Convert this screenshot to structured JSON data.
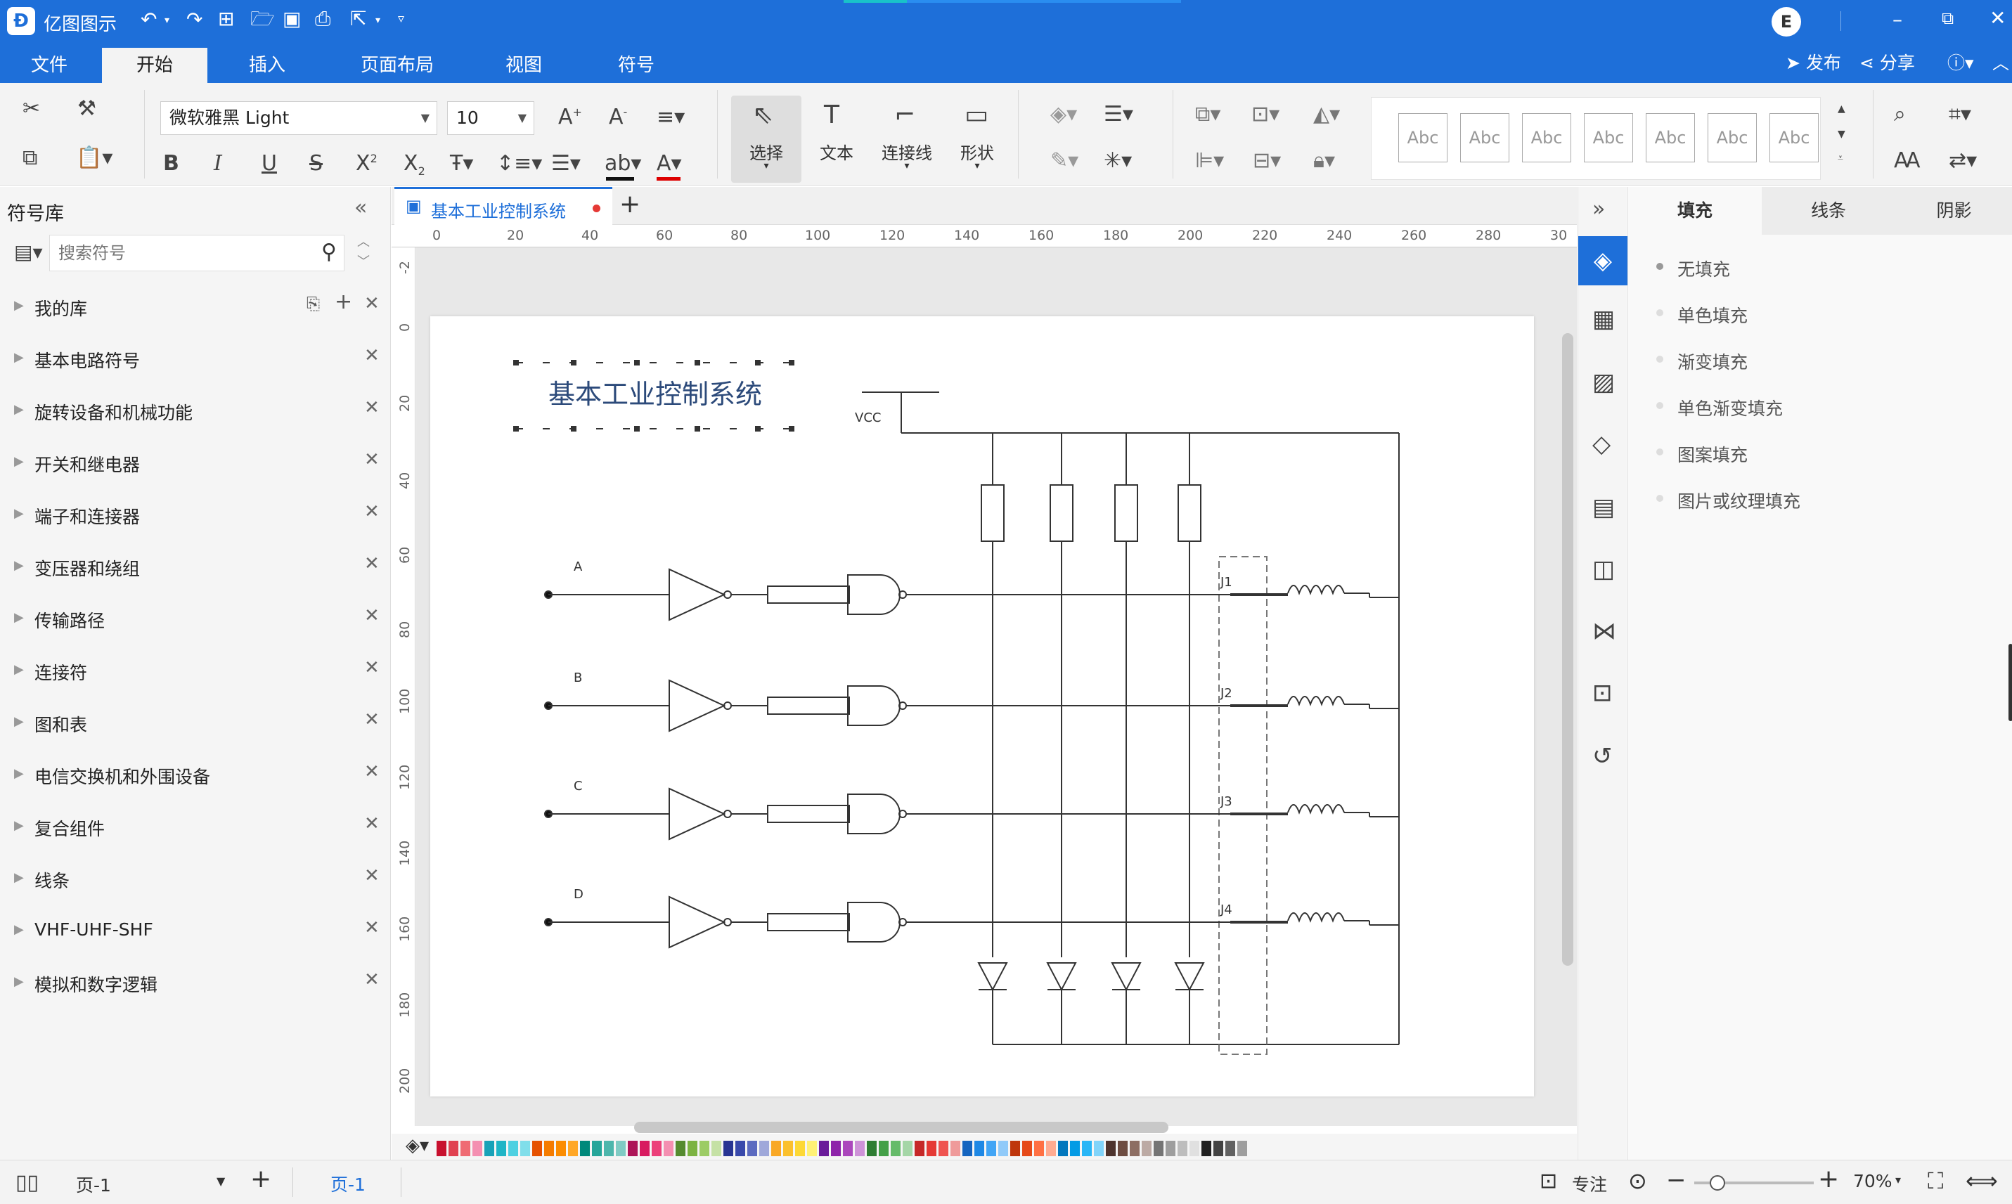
{
  "app": {
    "title": "亿图图示",
    "user_initial": "E"
  },
  "menu": {
    "tabs": [
      "文件",
      "开始",
      "插入",
      "页面布局",
      "视图",
      "符号"
    ],
    "active": "开始",
    "publish": "发布",
    "share": "分享"
  },
  "ribbon": {
    "font_name": "微软雅黑 Light",
    "font_size": "10",
    "tools": {
      "select": "选择",
      "text": "文本",
      "connector": "连接线",
      "shape": "形状"
    },
    "style_samples": [
      "Abc",
      "Abc",
      "Abc",
      "Abc",
      "Abc",
      "Abc",
      "Abc"
    ]
  },
  "library": {
    "title": "符号库",
    "search_placeholder": "搜索符号",
    "items": [
      "我的库",
      "基本电路符号",
      "旋转设备和机械功能",
      "开关和继电器",
      "端子和连接器",
      "变压器和绕组",
      "传输路径",
      "连接符",
      "图和表",
      "电信交换机和外围设备",
      "复合组件",
      "线条",
      "VHF-UHF-SHF",
      "模拟和数字逻辑"
    ]
  },
  "document": {
    "tab_title": "基本工业控制系统"
  },
  "ruler": {
    "h_labels": [
      "0",
      "20",
      "40",
      "60",
      "80",
      "100",
      "120",
      "140",
      "160",
      "180",
      "200",
      "220",
      "240",
      "260",
      "280",
      "30"
    ],
    "v_labels": [
      "-2",
      "0",
      "20",
      "40",
      "60",
      "80",
      "100",
      "120",
      "140",
      "160",
      "180",
      "200"
    ]
  },
  "diagram": {
    "title": "基本工业控制系统",
    "vcc": "VCC",
    "inputs": [
      "A",
      "B",
      "C",
      "D"
    ],
    "relays": [
      "J1",
      "J2",
      "J3",
      "J4"
    ]
  },
  "right_panel": {
    "tabs": [
      "填充",
      "线条",
      "阴影"
    ],
    "active_tab": "填充",
    "fill_options": [
      "无填充",
      "单色填充",
      "渐变填充",
      "单色渐变填充",
      "图案填充",
      "图片或纹理填充"
    ],
    "selected_fill": "无填充"
  },
  "status": {
    "page_selector": "页-1",
    "page_tab": "页-1",
    "focus": "专注",
    "zoom": "70%"
  },
  "colors": {
    "accent": "#1e6fd9",
    "doc_title": "#2c4a7a"
  },
  "palette": [
    "#c8102e",
    "#e04050",
    "#ef6b73",
    "#f48fb1",
    "#17a2b8",
    "#1fb5c6",
    "#4dd0e1",
    "#80deea",
    "#e65100",
    "#f57c00",
    "#fb8c00",
    "#ffa726",
    "#00897b",
    "#26a69a",
    "#4db6ac",
    "#80cbc4",
    "#ad1457",
    "#d81b60",
    "#ec407a",
    "#f48fb1",
    "#558b2f",
    "#7cb342",
    "#9ccc65",
    "#c5e1a5",
    "#283593",
    "#3949ab",
    "#5c6bc0",
    "#9fa8da",
    "#f9a825",
    "#fbc02d",
    "#fdd835",
    "#fff176",
    "#6a1b9a",
    "#8e24aa",
    "#ab47bc",
    "#ce93d8",
    "#2e7d32",
    "#43a047",
    "#66bb6a",
    "#a5d6a7",
    "#c62828",
    "#e53935",
    "#ef5350",
    "#ef9a9a",
    "#1565c0",
    "#1e88e5",
    "#42a5f5",
    "#90caf9",
    "#bf360c",
    "#e64a19",
    "#ff7043",
    "#ffab91",
    "#0277bd",
    "#039be5",
    "#29b6f6",
    "#81d4fa",
    "#4e342e",
    "#6d4c41",
    "#8d6e63",
    "#bcaaa4",
    "#757575",
    "#9e9e9e",
    "#bdbdbd",
    "#e0e0e0",
    "#212121",
    "#424242",
    "#616161",
    "#9e9e9e"
  ]
}
